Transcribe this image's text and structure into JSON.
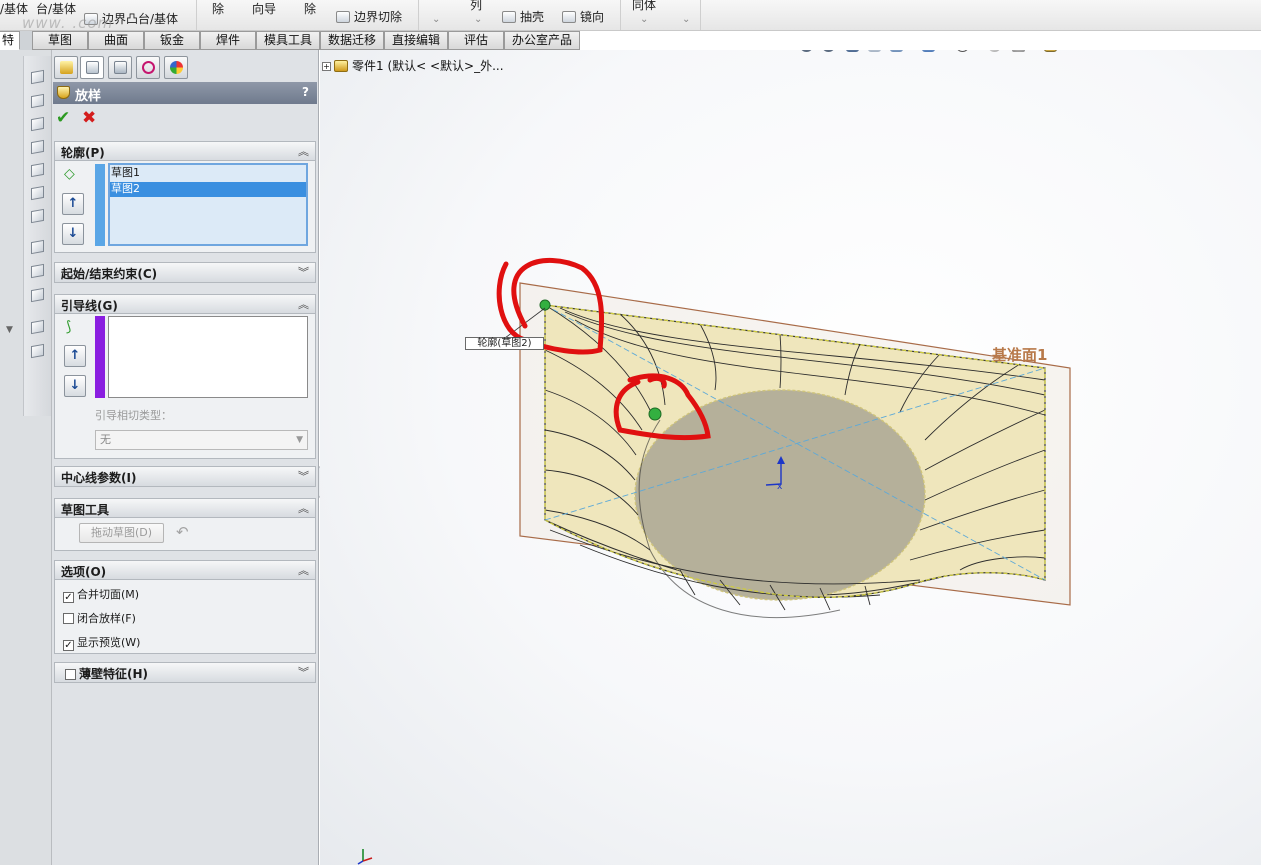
{
  "ribbon": {
    "items": [
      {
        "label": "/基体"
      },
      {
        "label": "台/基体"
      },
      {
        "label": "边界凸台/基体"
      },
      {
        "label": "除"
      },
      {
        "label": "向导"
      },
      {
        "label": "除"
      },
      {
        "label": "边界切除"
      },
      {
        "label": "列"
      },
      {
        "label": "抽壳"
      },
      {
        "label": "镜向"
      },
      {
        "label": "同体"
      }
    ],
    "watermark": "www.  .com"
  },
  "tabs": [
    {
      "label": "特征"
    },
    {
      "label": "草图"
    },
    {
      "label": "曲面"
    },
    {
      "label": "钣金"
    },
    {
      "label": "焊件"
    },
    {
      "label": "模具工具"
    },
    {
      "label": "数据迁移"
    },
    {
      "label": "直接编辑"
    },
    {
      "label": "评估"
    },
    {
      "label": "办公室产品"
    }
  ],
  "panel": {
    "title": "放样",
    "help": "?",
    "ok": "✔",
    "cancel": "✖",
    "profiles": {
      "header": "轮廓(P)",
      "items": [
        "草图1",
        "草图2"
      ],
      "selected_index": 1
    },
    "constraints": {
      "header": "起始/结束约束(C)"
    },
    "guides": {
      "header": "引导线(G)",
      "tangency_label": "引导相切类型：",
      "tangency_value": "无"
    },
    "centerline": {
      "header": "中心线参数(I)"
    },
    "sketch_tools": {
      "header": "草图工具",
      "drag_button": "拖动草图(D)"
    },
    "options": {
      "header": "选项(O)",
      "merge_faces": {
        "label": "合并切面(M)",
        "checked": true
      },
      "close_loft": {
        "label": "闭合放样(F)",
        "checked": false
      },
      "show_preview": {
        "label": "显示预览(W)",
        "checked": true
      }
    },
    "thin": {
      "header": "薄壁特征(H)",
      "checked": false
    }
  },
  "viewport": {
    "tree_label": "零件1  (默认< <默认>_外...",
    "callout": "轮廓(草图2)",
    "plane_label": "基准面1"
  },
  "colors": {
    "accent_blue": "#3a8fe0",
    "guide_purple": "#8a1ee0",
    "profile_blue": "#5aa6e6",
    "annotation_red": "#e01010",
    "plane_brown": "#b8794a"
  }
}
